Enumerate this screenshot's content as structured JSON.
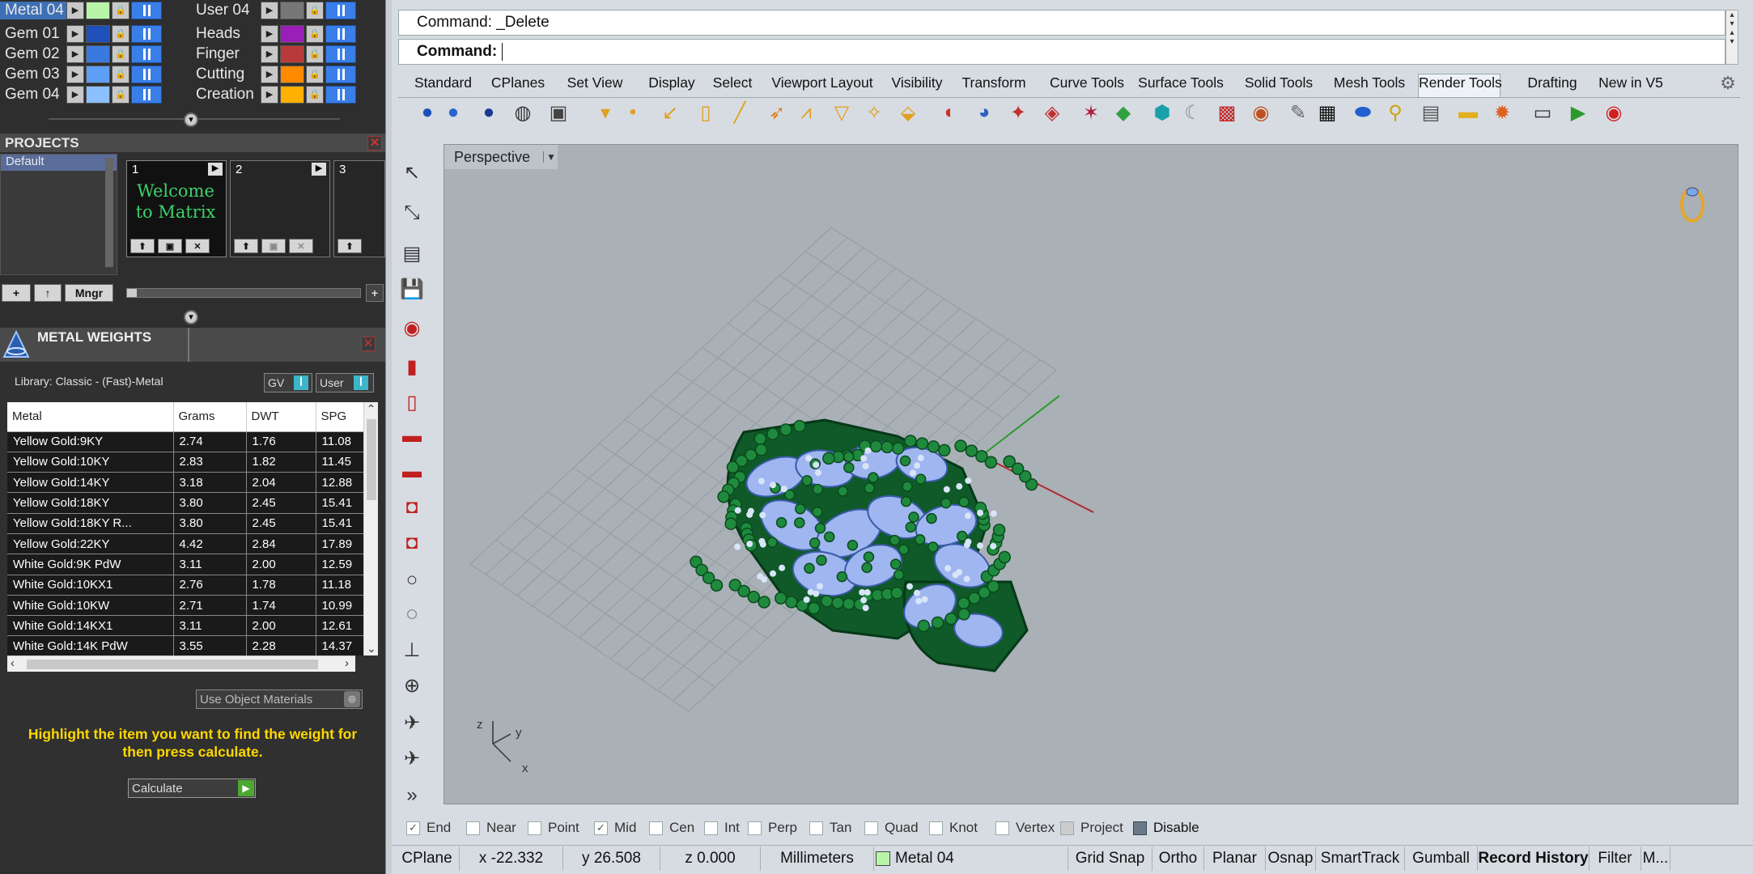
{
  "layers_left": [
    {
      "name": "Metal 04",
      "color": "#b8f5a8",
      "selected": true
    },
    {
      "name": "Gem 01",
      "color": "#1f4fb8",
      "selected": false
    },
    {
      "name": "Gem 02",
      "color": "#3a7ae0",
      "selected": false
    },
    {
      "name": "Gem 03",
      "color": "#5e9ef5",
      "selected": false
    },
    {
      "name": "Gem 04",
      "color": "#8cc0ff",
      "selected": false
    }
  ],
  "layers_right": [
    {
      "name": "User 04",
      "color": "#777777"
    },
    {
      "name": "Heads",
      "color": "#9a1fb8"
    },
    {
      "name": "Finger",
      "color": "#b83a3a"
    },
    {
      "name": "Cutting",
      "color": "#ff8a00"
    },
    {
      "name": "Creation",
      "color": "#ffb000"
    }
  ],
  "projects": {
    "title": "PROJECTS",
    "list": [
      "Default"
    ],
    "slots": [
      {
        "num": "1",
        "thumb_text": "Welcome to Matrix"
      },
      {
        "num": "2",
        "thumb_text": ""
      },
      {
        "num": "3",
        "thumb_text": ""
      }
    ],
    "manager_label": "Mngr"
  },
  "metal_weights": {
    "title": "METAL WEIGHTS",
    "library": "Library: Classic - (Fast)-Metal",
    "gv_label": "GV",
    "user_label": "User",
    "columns": [
      "Metal",
      "Grams",
      "DWT",
      "SPG"
    ],
    "rows": [
      [
        "Yellow Gold:9KY",
        "2.74",
        "1.76",
        "11.08"
      ],
      [
        "Yellow Gold:10KY",
        "2.83",
        "1.82",
        "11.45"
      ],
      [
        "Yellow Gold:14KY",
        "3.18",
        "2.04",
        "12.88"
      ],
      [
        "Yellow Gold:18KY",
        "3.80",
        "2.45",
        "15.41"
      ],
      [
        "Yellow Gold:18KY R...",
        "3.80",
        "2.45",
        "15.41"
      ],
      [
        "Yellow Gold:22KY",
        "4.42",
        "2.84",
        "17.89"
      ],
      [
        "White Gold:9K PdW",
        "3.11",
        "2.00",
        "12.59"
      ],
      [
        "White Gold:10KX1",
        "2.76",
        "1.78",
        "11.18"
      ],
      [
        "White Gold:10KW",
        "2.71",
        "1.74",
        "10.99"
      ],
      [
        "White Gold:14KX1",
        "3.11",
        "2.00",
        "12.61"
      ],
      [
        "White Gold:14K PdW",
        "3.55",
        "2.28",
        "14.37"
      ]
    ],
    "materials_dropdown": "Use Object Materials",
    "instruction": "Highlight the item you want to find the weight for then press calculate.",
    "calculate_label": "Calculate"
  },
  "command": {
    "history": "Command: _Delete",
    "prompt": "Command:"
  },
  "tabs": [
    "Standard",
    "CPlanes",
    "Set View",
    "Display",
    "Select",
    "Viewport Layout",
    "Visibility",
    "Transform",
    "Curve Tools",
    "Surface Tools",
    "Solid Tools",
    "Mesh Tools",
    "Render Tools",
    "Drafting",
    "New in V5"
  ],
  "active_tab": "Render Tools",
  "viewport": {
    "name": "Perspective",
    "axis_z": "z",
    "axis_y": "y",
    "axis_x": "x"
  },
  "osnaps": [
    {
      "label": "End",
      "checked": true
    },
    {
      "label": "Near",
      "checked": false
    },
    {
      "label": "Point",
      "checked": false
    },
    {
      "label": "Mid",
      "checked": true
    },
    {
      "label": "Cen",
      "checked": false
    },
    {
      "label": "Int",
      "checked": false
    },
    {
      "label": "Perp",
      "checked": false
    },
    {
      "label": "Tan",
      "checked": false
    },
    {
      "label": "Quad",
      "checked": false
    },
    {
      "label": "Knot",
      "checked": false
    },
    {
      "label": "Vertex",
      "checked": false
    },
    {
      "label": "Project",
      "checked": false
    },
    {
      "label": "Disable",
      "checked": false
    }
  ],
  "status": {
    "cplane": "CPlane",
    "x": "x -22.332",
    "y": "y 26.508",
    "z": "z 0.000",
    "units": "Millimeters",
    "layer": "Metal 04",
    "layer_color": "#b8f5a8",
    "grid_snap": "Grid Snap",
    "ortho": "Ortho",
    "planar": "Planar",
    "osnap": "Osnap",
    "smarttrack": "SmartTrack",
    "gumball": "Gumball",
    "record_history": "Record History",
    "filter": "Filter",
    "more": "M..."
  }
}
